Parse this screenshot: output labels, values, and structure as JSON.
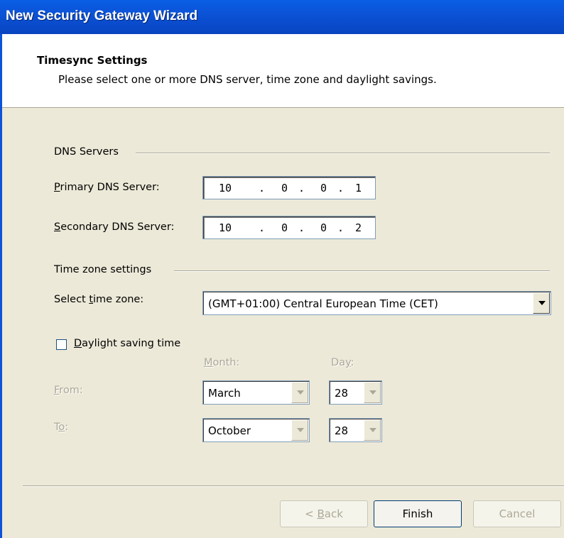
{
  "window": {
    "title": "New Security Gateway Wizard"
  },
  "header": {
    "title": "Timesync Settings",
    "subtitle": "Please select one or more DNS server, time zone and daylight savings."
  },
  "dns": {
    "group_label": "DNS Servers",
    "primary_label_mnemonic": "P",
    "primary_label_rest": "rimary DNS Server:",
    "primary_octets": [
      "10",
      "0",
      "0",
      "1"
    ],
    "secondary_label_mnemonic": "S",
    "secondary_label_rest": "econdary DNS Server:",
    "secondary_octets": [
      "10",
      "0",
      "0",
      "2"
    ],
    "dot": "."
  },
  "timezone": {
    "group_label": "Time zone settings",
    "select_label_pre": "Select ",
    "select_label_mnemonic": "t",
    "select_label_rest": "ime zone:",
    "selected": "(GMT+01:00) Central European Time (CET)"
  },
  "daylight": {
    "checkbox_mnemonic": "D",
    "checkbox_rest": "aylight saving time",
    "checked": false,
    "month_header_mnemonic": "M",
    "month_header_rest": "onth:",
    "day_header_pre": "Da",
    "day_header_mnemonic": "y",
    "day_header_rest": ":",
    "from_label_mnemonic": "F",
    "from_label_rest": "rom:",
    "to_label_pre": "T",
    "to_label_mnemonic": "o",
    "to_label_rest": ":",
    "from_month": "March",
    "from_day": "28",
    "to_month": "October",
    "to_day": "28"
  },
  "buttons": {
    "back_prefix": "< ",
    "back_mnemonic": "B",
    "back_rest": "ack",
    "finish": "Finish",
    "cancel": "Cancel"
  },
  "colors": {
    "titlebar": "#0b53d7",
    "dialog_bg": "#ece9d8",
    "disabled_text": "#aca899"
  }
}
